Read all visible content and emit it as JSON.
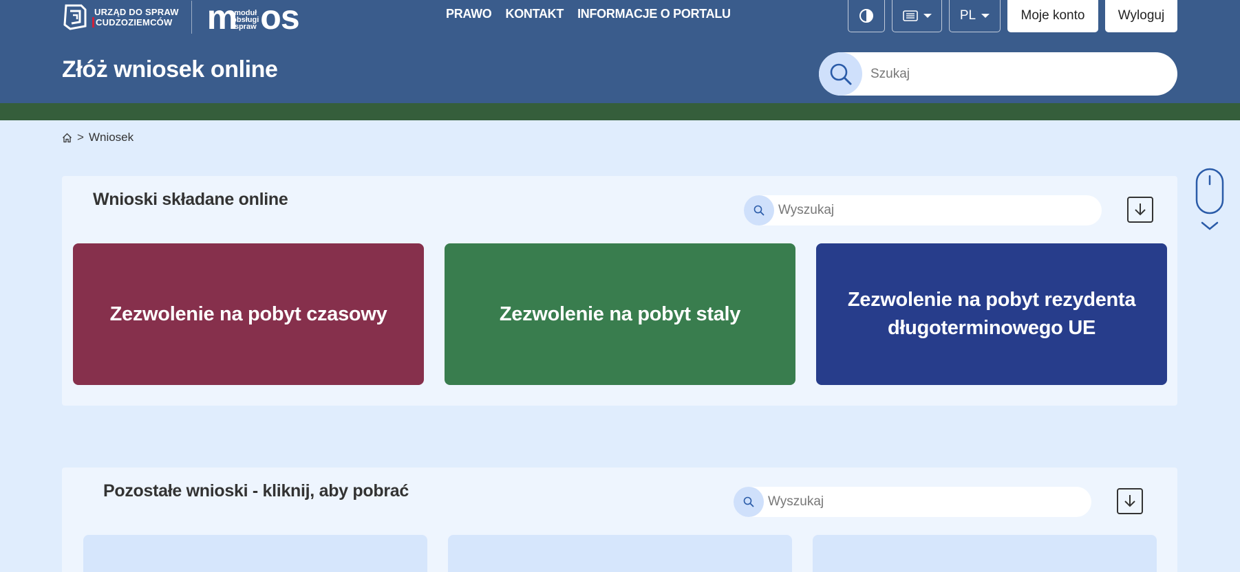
{
  "header": {
    "udsc_line1": "URZĄD DO SPRAW",
    "udsc_line2": "CUDZOZIEMCÓW",
    "mos_small": [
      "moduł",
      "obsługi",
      "spraw"
    ],
    "mos_m": "m",
    "mos_os": "os",
    "nav": [
      "PRAWO",
      "KONTAKT",
      "INFORMACJE O PORTALU"
    ],
    "lang": "PL",
    "account_label": "Moje konto",
    "logout_label": "Wyloguj",
    "page_title": "Złóż wniosek online",
    "search_placeholder": "Szukaj"
  },
  "breadcrumb": {
    "current": "Wniosek",
    "separator": ">"
  },
  "panel_online": {
    "title": "Wnioski składane online",
    "search_placeholder": "Wyszukaj",
    "tiles": [
      {
        "label": "Zezwolenie na pobyt czasowy",
        "color": "#86304c"
      },
      {
        "label": "Zezwolenie na pobyt staly",
        "color": "#397d4e"
      },
      {
        "label": "Zezwolenie na pobyt rezydenta długoterminowego UE",
        "color": "#273d8b"
      }
    ]
  },
  "panel_other": {
    "title": "Pozostałe wnioski - kliknij, aby pobrać",
    "search_placeholder": "Wyszukaj"
  },
  "colors": {
    "header_bg": "#3a5c8c",
    "accent_green": "#355e3b",
    "page_bg": "#e0edfd",
    "panel_bg": "#eef5fe",
    "search_circle": "#cfe0fb",
    "udsc_red": "#d0213a"
  },
  "icons": [
    "udsc-emblem-icon",
    "contrast-icon",
    "list-icon",
    "search-icon",
    "home-icon",
    "download-icon",
    "mouse-icon",
    "chevron-down-icon"
  ]
}
